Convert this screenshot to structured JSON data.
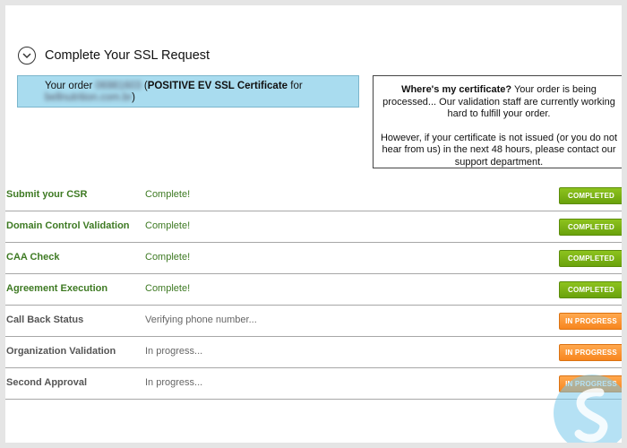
{
  "header": {
    "title": "Complete Your SSL Request"
  },
  "order": {
    "prefix": "Your order",
    "order_number": "06981603",
    "product": "POSITIVE EV SSL Certificate",
    "for_text": "for",
    "domain": "bellnutrition.com.br"
  },
  "info": {
    "heading": "Where's my certificate?",
    "line1": "Your order is being processed... Our validation staff are currently working hard to fulfill your order.",
    "line2": "However, if your certificate is not issued (or you do not hear from us) in the next 48 hours, please contact our support department."
  },
  "steps": [
    {
      "name": "Submit your CSR",
      "status": "Complete!",
      "badge": "COMPLETED",
      "state": "done"
    },
    {
      "name": "Domain Control Validation",
      "status": "Complete!",
      "badge": "COMPLETED",
      "state": "done"
    },
    {
      "name": "CAA Check",
      "status": "Complete!",
      "badge": "COMPLETED",
      "state": "done"
    },
    {
      "name": "Agreement Execution",
      "status": "Complete!",
      "badge": "COMPLETED",
      "state": "done"
    },
    {
      "name": "Call Back Status",
      "status": "Verifying phone number...",
      "badge": "IN PROGRESS",
      "state": "pending"
    },
    {
      "name": "Organization Validation",
      "status": "In progress...",
      "badge": "IN PROGRESS",
      "state": "pending"
    },
    {
      "name": "Second Approval",
      "status": "In progress...",
      "badge": "IN PROGRESS",
      "state": "pending"
    }
  ],
  "colors": {
    "completed_badge": "#79b215",
    "progress_badge": "#f7921f",
    "order_box": "#a9dcef"
  },
  "icons": {
    "collapse": "chevron-down-icon",
    "watermark": "logo-icon"
  }
}
